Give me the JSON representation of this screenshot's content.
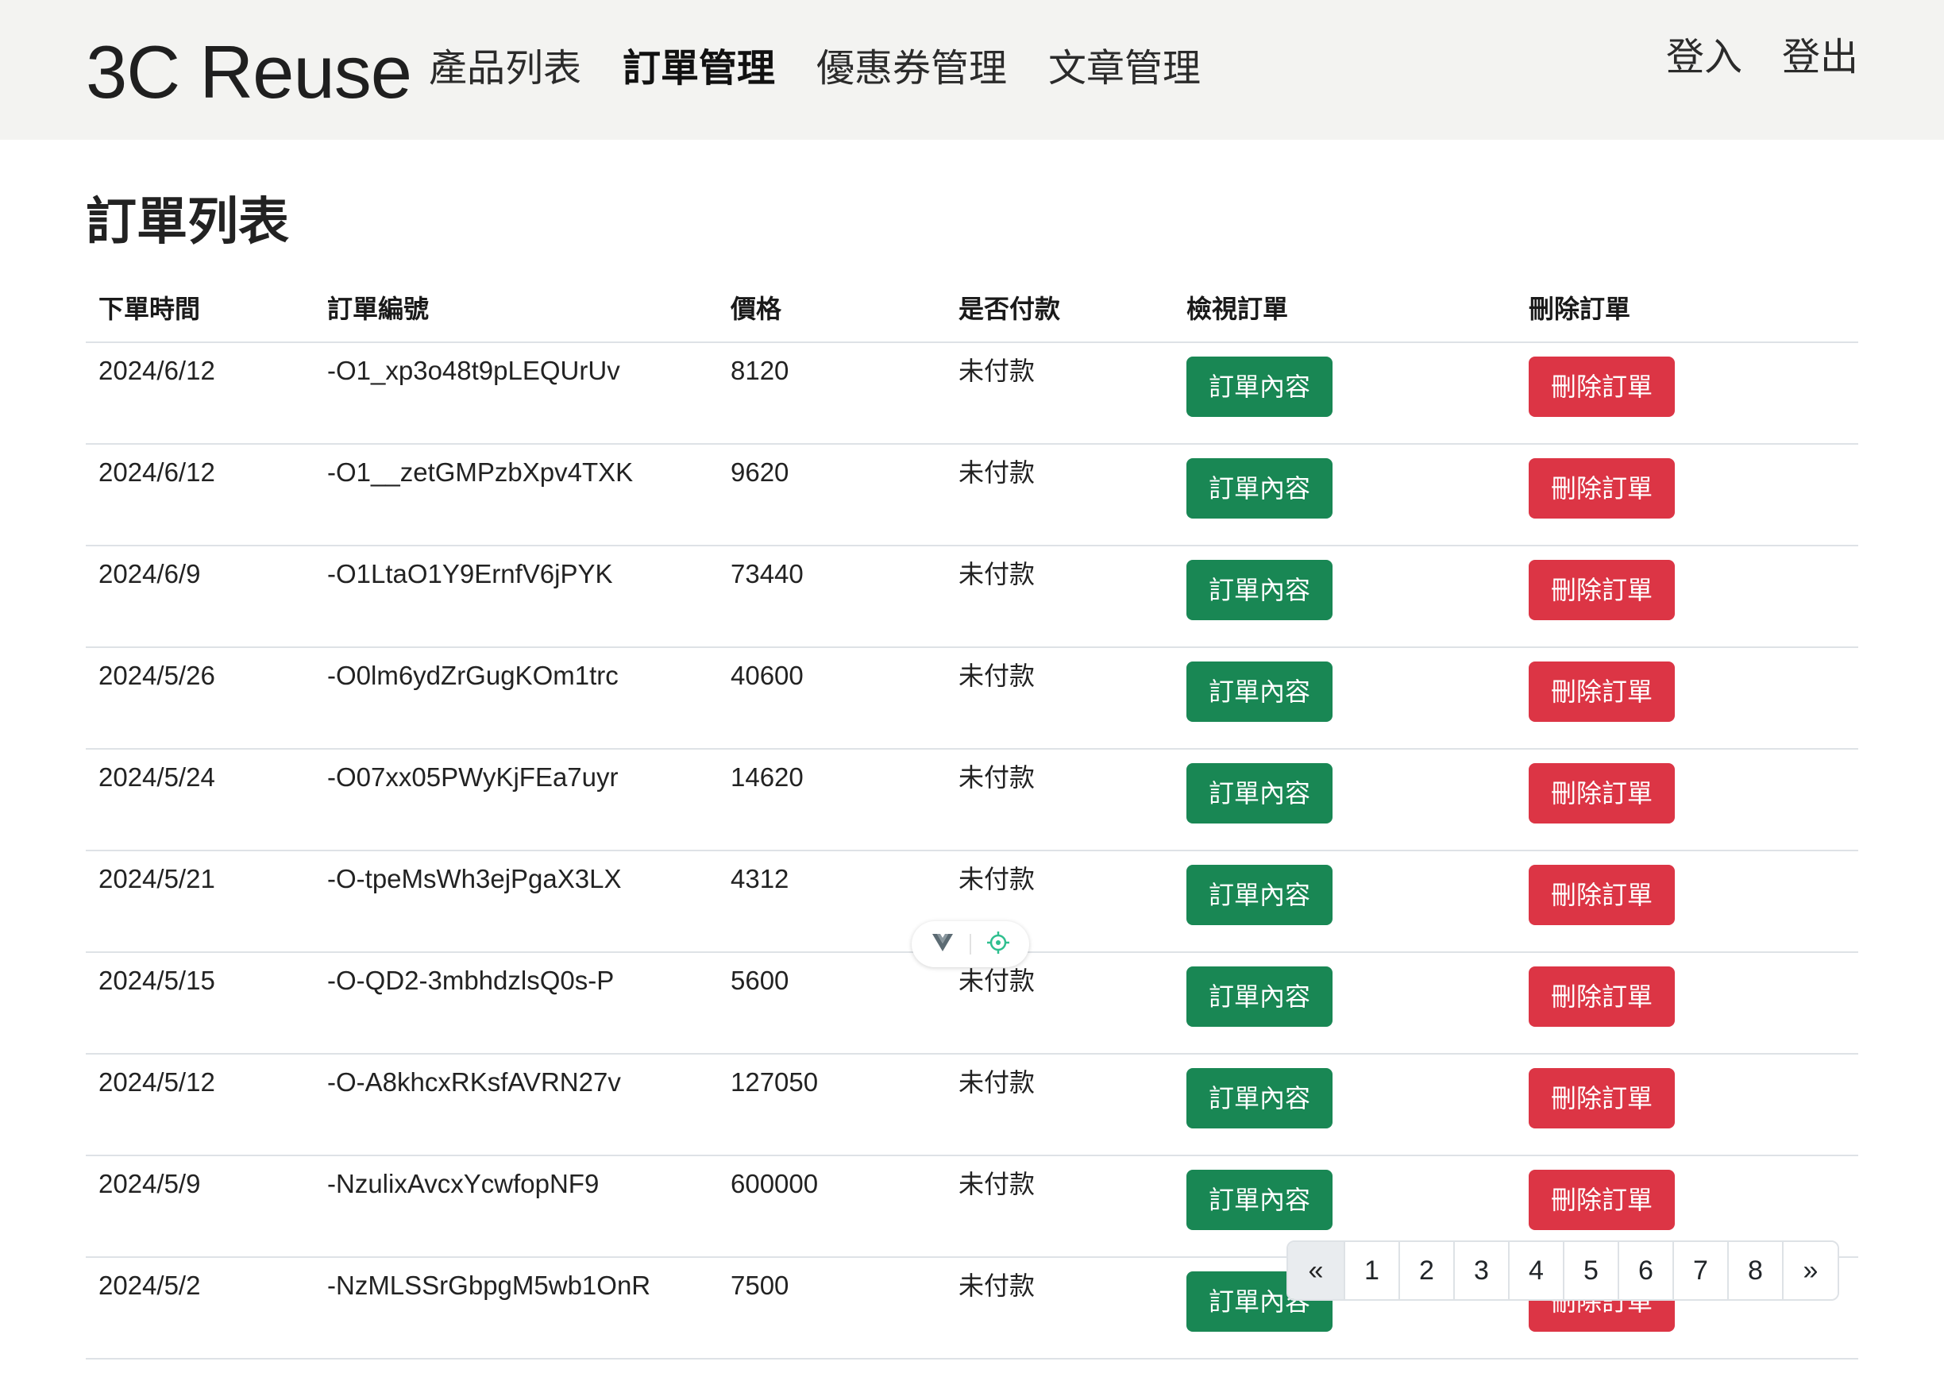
{
  "navbar": {
    "brand": "3C Reuse",
    "links": [
      {
        "label": "產品列表",
        "active": false
      },
      {
        "label": "訂單管理",
        "active": true
      },
      {
        "label": "優惠券管理",
        "active": false
      },
      {
        "label": "文章管理",
        "active": false
      }
    ],
    "login": "登入",
    "logout": "登出"
  },
  "page": {
    "title": "訂單列表"
  },
  "table": {
    "headers": [
      "下單時間",
      "訂單編號",
      "價格",
      "是否付款",
      "檢視訂單",
      "刪除訂單"
    ],
    "rows": [
      {
        "date": "2024/6/12",
        "id": "-O1_xp3o48t9pLEQUrUv",
        "price": "8120",
        "paid": "未付款",
        "view_label": "訂單內容",
        "delete_label": "刪除訂單"
      },
      {
        "date": "2024/6/12",
        "id": "-O1__zetGMPzbXpv4TXK",
        "price": "9620",
        "paid": "未付款",
        "view_label": "訂單內容",
        "delete_label": "刪除訂單"
      },
      {
        "date": "2024/6/9",
        "id": "-O1LtaO1Y9ErnfV6jPYK",
        "price": "73440",
        "paid": "未付款",
        "view_label": "訂單內容",
        "delete_label": "刪除訂單"
      },
      {
        "date": "2024/5/26",
        "id": "-O0lm6ydZrGugKOm1trc",
        "price": "40600",
        "paid": "未付款",
        "view_label": "訂單內容",
        "delete_label": "刪除訂單"
      },
      {
        "date": "2024/5/24",
        "id": "-O07xx05PWyKjFEa7uyr",
        "price": "14620",
        "paid": "未付款",
        "view_label": "訂單內容",
        "delete_label": "刪除訂單"
      },
      {
        "date": "2024/5/21",
        "id": "-O-tpeMsWh3ejPgaX3LX",
        "price": "4312",
        "paid": "未付款",
        "view_label": "訂單內容",
        "delete_label": "刪除訂單"
      },
      {
        "date": "2024/5/15",
        "id": "-O-QD2-3mbhdzlsQ0s-P",
        "price": "5600",
        "paid": "未付款",
        "view_label": "訂單內容",
        "delete_label": "刪除訂單"
      },
      {
        "date": "2024/5/12",
        "id": "-O-A8khcxRKsfAVRN27v",
        "price": "127050",
        "paid": "未付款",
        "view_label": "訂單內容",
        "delete_label": "刪除訂單"
      },
      {
        "date": "2024/5/9",
        "id": "-NzulixAvcxYcwfopNF9",
        "price": "600000",
        "paid": "未付款",
        "view_label": "訂單內容",
        "delete_label": "刪除訂單"
      },
      {
        "date": "2024/5/2",
        "id": "-NzMLSSrGbpgM5wb1OnR",
        "price": "7500",
        "paid": "未付款",
        "view_label": "訂單內容",
        "delete_label": "刪除訂單"
      }
    ]
  },
  "pagination": {
    "prev": "«",
    "pages": [
      "1",
      "2",
      "3",
      "4",
      "5",
      "6",
      "7",
      "8"
    ],
    "next": "»"
  },
  "devtools": {
    "icons": [
      "vue-logo-icon",
      "target-icon"
    ]
  },
  "colors": {
    "success": "#198754",
    "danger": "#dc3545",
    "navbar_bg": "#f3f3f1"
  }
}
